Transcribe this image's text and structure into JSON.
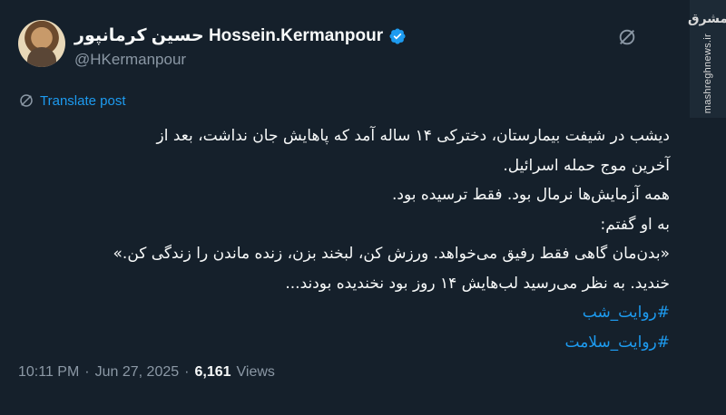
{
  "author": {
    "display_name": "حسین کرمانپور Hossein.Kermanpour",
    "handle": "@HKermanpour",
    "avatar_icon": "avatar-photo"
  },
  "translate_label": "Translate post",
  "watermark": {
    "mark": "مشرق",
    "site": "mashreghnews.ir"
  },
  "tweet": {
    "lines": [
      "دیشب در شیفت بیمارستان، دخترکی ۱۴ ساله آمد که پاهایش جان نداشت، بعد از",
      "آخرین موج حمله اسرائیل.",
      "همه آزمایش‌ها نرمال بود. فقط ترسیده بود.",
      "به او گفتم:",
      "«بدن‌مان گاهی فقط رفیق می‌خواهد. ورزش کن، لبخند بزن، زنده ماندن را زندگی کن.»",
      "خندید. به نظر می‌رسید لب‌هایش ۱۴ روز بود نخندیده بودند..."
    ],
    "hashtags": [
      "#روایت_شب",
      "#روایت_سلامت"
    ]
  },
  "meta": {
    "time": "10:11 PM",
    "separator": "·",
    "date": "Jun 27, 2025",
    "views_count": "6,161",
    "views_label": "Views"
  },
  "colors": {
    "background": "#15202b",
    "accent": "#1d9bf0",
    "muted": "#8b98a5"
  }
}
